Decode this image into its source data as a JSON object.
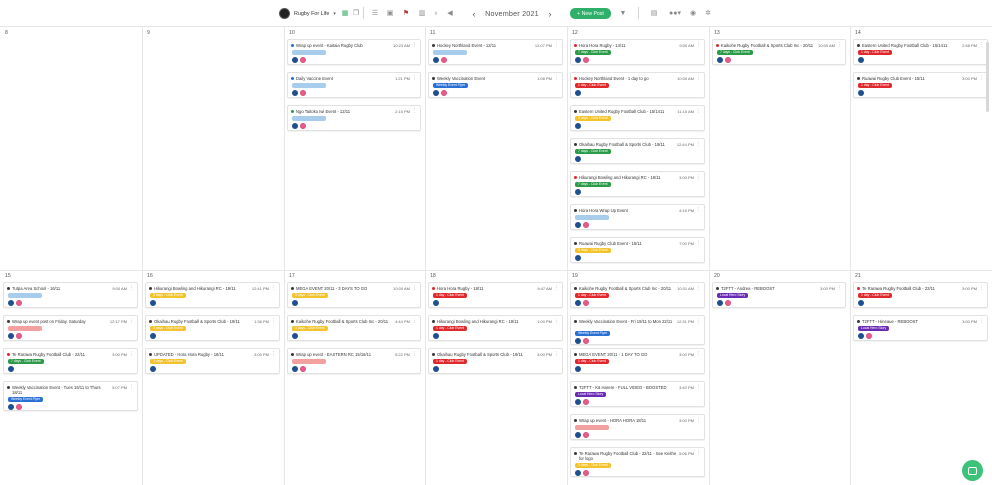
{
  "toolbar": {
    "workspace": "Rugby For Life",
    "month": "November 2021",
    "new_post": "+ New Post",
    "icons": [
      "calendar-icon",
      "copy-icon",
      "list-icon",
      "image-icon",
      "flag-icon",
      "library-icon",
      "bulb-icon",
      "megaphone-icon",
      "filter-icon",
      "book-icon",
      "team-icon",
      "help-icon",
      "settings-icon"
    ]
  },
  "colors": {
    "red": "#e0292d",
    "green": "#2e9b4a",
    "yellow": "#f3c32c",
    "lightblue": "#a7ccec",
    "pink": "#f2a0a0",
    "blue": "#2a6fd4",
    "purple": "#6a2bb4"
  },
  "weeks": [
    {
      "days": [
        {
          "label": "8",
          "events": []
        },
        {
          "label": "9",
          "events": []
        },
        {
          "label": "10",
          "events": [
            {
              "title": "Wrap up event - Kaitaia Rugby Club",
              "time": "10:23 AM",
              "dot": "blue",
              "tag": "",
              "tagColor": "lightblue",
              "icons": [
                "fb",
                "ig"
              ]
            },
            {
              "title": "Daily Vaccine Event",
              "time": "1:21 PM",
              "dot": "blue",
              "tag": "",
              "tagColor": "lightblue",
              "icons": [
                "fb",
                "ig"
              ]
            },
            {
              "title": "Ngo Taitoko Iwi Event - 12/11",
              "time": "2:15 PM",
              "dot": "green",
              "tag": "",
              "tagColor": "lightblue",
              "icons": [
                "fb",
                "ig"
              ]
            }
          ]
        },
        {
          "label": "11",
          "events": [
            {
              "title": "Hockey Northland Event - 12/11",
              "time": "12:07 PM",
              "dot": "black",
              "tag": "",
              "tagColor": "lightblue",
              "icons": [
                "fb",
                "ig"
              ]
            },
            {
              "title": "Weekly Vaccination Event",
              "time": "1:08 PM",
              "dot": "black",
              "tag": "Weekly Event Flyer",
              "tagColor": "blue",
              "icons": [
                "fb",
                "ig"
              ]
            }
          ]
        },
        {
          "label": "12",
          "events": [
            {
              "title": "Hora Hora Rugby - 14/11",
              "time": "9:00 AM",
              "dot": "red",
              "tag": "7 days - Club Event",
              "tagColor": "green",
              "icons": [
                "fb",
                "ig"
              ]
            },
            {
              "title": "Hockey Northland Event - 1 day to go",
              "time": "10:00 AM",
              "dot": "red",
              "tag": "1 day - Club Event",
              "tagColor": "red",
              "icons": [
                "fb"
              ]
            },
            {
              "title": "Eastern United Rugby Football Club - 15/1411",
              "time": "11:15 AM",
              "dot": "black",
              "tag": "3 days - Club Event",
              "tagColor": "yellow",
              "icons": [
                "fb"
              ]
            },
            {
              "title": "Okaihau Rugby Football & Sports Club - 19/11",
              "time": "12:44 PM",
              "dot": "black",
              "tag": "7 days - Club Event",
              "tagColor": "green",
              "icons": [
                "fb"
              ]
            },
            {
              "title": "Hikurangi Bowling and Hikurangi RC - 19/11",
              "time": "3:00 PM",
              "dot": "red",
              "tag": "7 days - Club Event",
              "tagColor": "green",
              "icons": [
                "fb"
              ]
            },
            {
              "title": "Hora Hora Wrap Up Event",
              "time": "4:15 PM",
              "dot": "black",
              "tag": "",
              "tagColor": "lightblue",
              "icons": [
                "fb",
                "ig"
              ]
            },
            {
              "title": "Ruawai Rugby Club Event - 15/11",
              "time": "7:00 PM",
              "dot": "black",
              "tag": "3 days - Club Event",
              "tagColor": "yellow",
              "icons": [
                "fb"
              ]
            }
          ]
        },
        {
          "label": "13",
          "events": [
            {
              "title": "Kaikohe Rugby Football & Sports Club Inc - 20/11",
              "time": "10:00 AM",
              "dot": "red",
              "tag": "7 days - Club Event",
              "tagColor": "green",
              "icons": [
                "fb",
                "ig"
              ]
            }
          ]
        },
        {
          "label": "14",
          "events": [
            {
              "title": "Eastern United Rugby Football Club - 15/1411",
              "time": "2:58 PM",
              "dot": "black",
              "tag": "1 day - Club Event",
              "tagColor": "red",
              "icons": [
                "fb"
              ]
            },
            {
              "title": "Ruawai Rugby Club Event - 15/11",
              "time": "3:00 PM",
              "dot": "black",
              "tag": "1 day - Club Event",
              "tagColor": "red",
              "icons": [
                "fb"
              ]
            }
          ]
        }
      ]
    },
    {
      "days": [
        {
          "label": "15",
          "events": [
            {
              "title": "Tutpa Area School - 16/11",
              "time": "9:00 AM",
              "dot": "black",
              "tag": "",
              "tagColor": "lightblue",
              "icons": [
                "fb",
                "ig"
              ]
            },
            {
              "title": "Wrap up event post on Friday. Saturday",
              "time": "12:17 PM",
              "dot": "black",
              "tag": "",
              "tagColor": "pink",
              "icons": [
                "fb",
                "ig"
              ]
            },
            {
              "title": "Te Rarawa Rugby Football Club - 22/11",
              "time": "3:00 PM",
              "dot": "red",
              "tag": "7 days - Club Event",
              "tagColor": "green",
              "icons": [
                "fb"
              ]
            },
            {
              "title": "Weekly Vaccination Event - Tues 16/11 to Thurs 18/11",
              "time": "5:07 PM",
              "dot": "black",
              "tag": "Weekly Event Flyer",
              "tagColor": "blue",
              "icons": [
                "fb",
                "ig"
              ]
            }
          ]
        },
        {
          "label": "16",
          "events": [
            {
              "title": "Hikurangi Bowling and Hikurangi RC - 19/11",
              "time": "12:41 PM",
              "dot": "black",
              "tag": "3 days - Club Event",
              "tagColor": "yellow",
              "icons": [
                "fb"
              ]
            },
            {
              "title": "Okaihau Rugby Football & Sports Club - 19/11",
              "time": "1:36 PM",
              "dot": "black",
              "tag": "3 days - Club Event",
              "tagColor": "yellow",
              "icons": [
                "fb"
              ]
            },
            {
              "title": "UPDATED - Hora Hora Rugby - 18/11",
              "time": "3:00 PM",
              "dot": "black",
              "tag": "3 days - Club Event",
              "tagColor": "yellow",
              "icons": [
                "fb"
              ]
            }
          ]
        },
        {
          "label": "17",
          "events": [
            {
              "title": "MEGA EVENT 20/11 - 3 DAYS TO GO",
              "time": "10:00 AM",
              "dot": "black",
              "tag": "3 days - Club Event",
              "tagColor": "yellow",
              "icons": [
                "fb"
              ]
            },
            {
              "title": "Kaikohe Rugby Football & Sports Club Inc - 20/11",
              "time": "4:44 PM",
              "dot": "black",
              "tag": "3 days - Club Event",
              "tagColor": "yellow",
              "icons": [
                "fb"
              ]
            },
            {
              "title": "Wrap up event - EASTERN RC 15/16/11",
              "time": "5:22 PM",
              "dot": "black",
              "tag": "",
              "tagColor": "pink",
              "icons": [
                "fb",
                "ig"
              ]
            }
          ]
        },
        {
          "label": "18",
          "events": [
            {
              "title": "Hora Hora Rugby - 18/11",
              "time": "9:47 AM",
              "dot": "red",
              "tag": "1 day - Club Event",
              "tagColor": "red",
              "icons": [
                "fb"
              ]
            },
            {
              "title": "Hikurangi Bowling and Hikurangi RC - 19/11",
              "time": "1:00 PM",
              "dot": "black",
              "tag": "1 day - Club Event",
              "tagColor": "red",
              "icons": [
                "fb"
              ]
            },
            {
              "title": "Okaihau Rugby Football & Sports Club - 19/11",
              "time": "3:00 PM",
              "dot": "black",
              "tag": "1 day - Club Event",
              "tagColor": "red",
              "icons": [
                "fb"
              ]
            }
          ]
        },
        {
          "label": "19",
          "events": [
            {
              "title": "Kaikohe Rugby Football & Sports Club Inc - 20/11",
              "time": "10:31 AM",
              "dot": "black",
              "tag": "1 day - Club Event",
              "tagColor": "red",
              "icons": [
                "fb",
                "ig"
              ]
            },
            {
              "title": "Weekly Vaccination Event - Fri 19/11 to Mon 22/11",
              "time": "12:31 PM",
              "dot": "black",
              "tag": "Weekly Event Flyer",
              "tagColor": "blue",
              "icons": [
                "fb",
                "ig"
              ]
            },
            {
              "title": "MEGA EVENT 20/11 - 1 DAY TO GO",
              "time": "3:00 PM",
              "dot": "black",
              "tag": "1 day - Club Event",
              "tagColor": "red",
              "icons": [
                "fb"
              ]
            },
            {
              "title": "T2FTT - Kā Harere - FULL VIDEO - BOOSTED",
              "time": "3:40 PM",
              "dot": "black",
              "tag": "Local Hero Story",
              "tagColor": "purple",
              "icons": [
                "fb",
                "ig"
              ]
            },
            {
              "title": "Wrap up event - HORA HORA 18/11",
              "time": "3:00 PM",
              "dot": "black",
              "tag": "",
              "tagColor": "pink",
              "icons": [
                "fb",
                "ig"
              ]
            },
            {
              "title": "Te Rarawa Rugby Football Club - 22/11 - See Keithe for logo",
              "time": "5:06 PM",
              "dot": "black",
              "tag": "3 days - Club Event",
              "tagColor": "yellow",
              "icons": [
                "fb",
                "ig"
              ]
            }
          ]
        },
        {
          "label": "20",
          "events": [
            {
              "title": "T2FTT - Andrea - REBOOST",
              "time": "3:00 PM",
              "dot": "black",
              "tag": "Local Hero Story",
              "tagColor": "purple",
              "icons": [
                "fb",
                "ig"
              ]
            }
          ]
        },
        {
          "label": "21",
          "events": [
            {
              "title": "Te Rarawa Rugby Football Club - 22/11",
              "time": "3:00 PM",
              "dot": "red",
              "tag": "1 day - Club Event",
              "tagColor": "red",
              "icons": [
                "fb"
              ]
            },
            {
              "title": "T2FTT - Hineaue - REBOOST",
              "time": "3:00 PM",
              "dot": "black",
              "tag": "Local Hero Story",
              "tagColor": "purple",
              "icons": [
                "fb",
                "ig"
              ]
            }
          ]
        }
      ]
    }
  ]
}
